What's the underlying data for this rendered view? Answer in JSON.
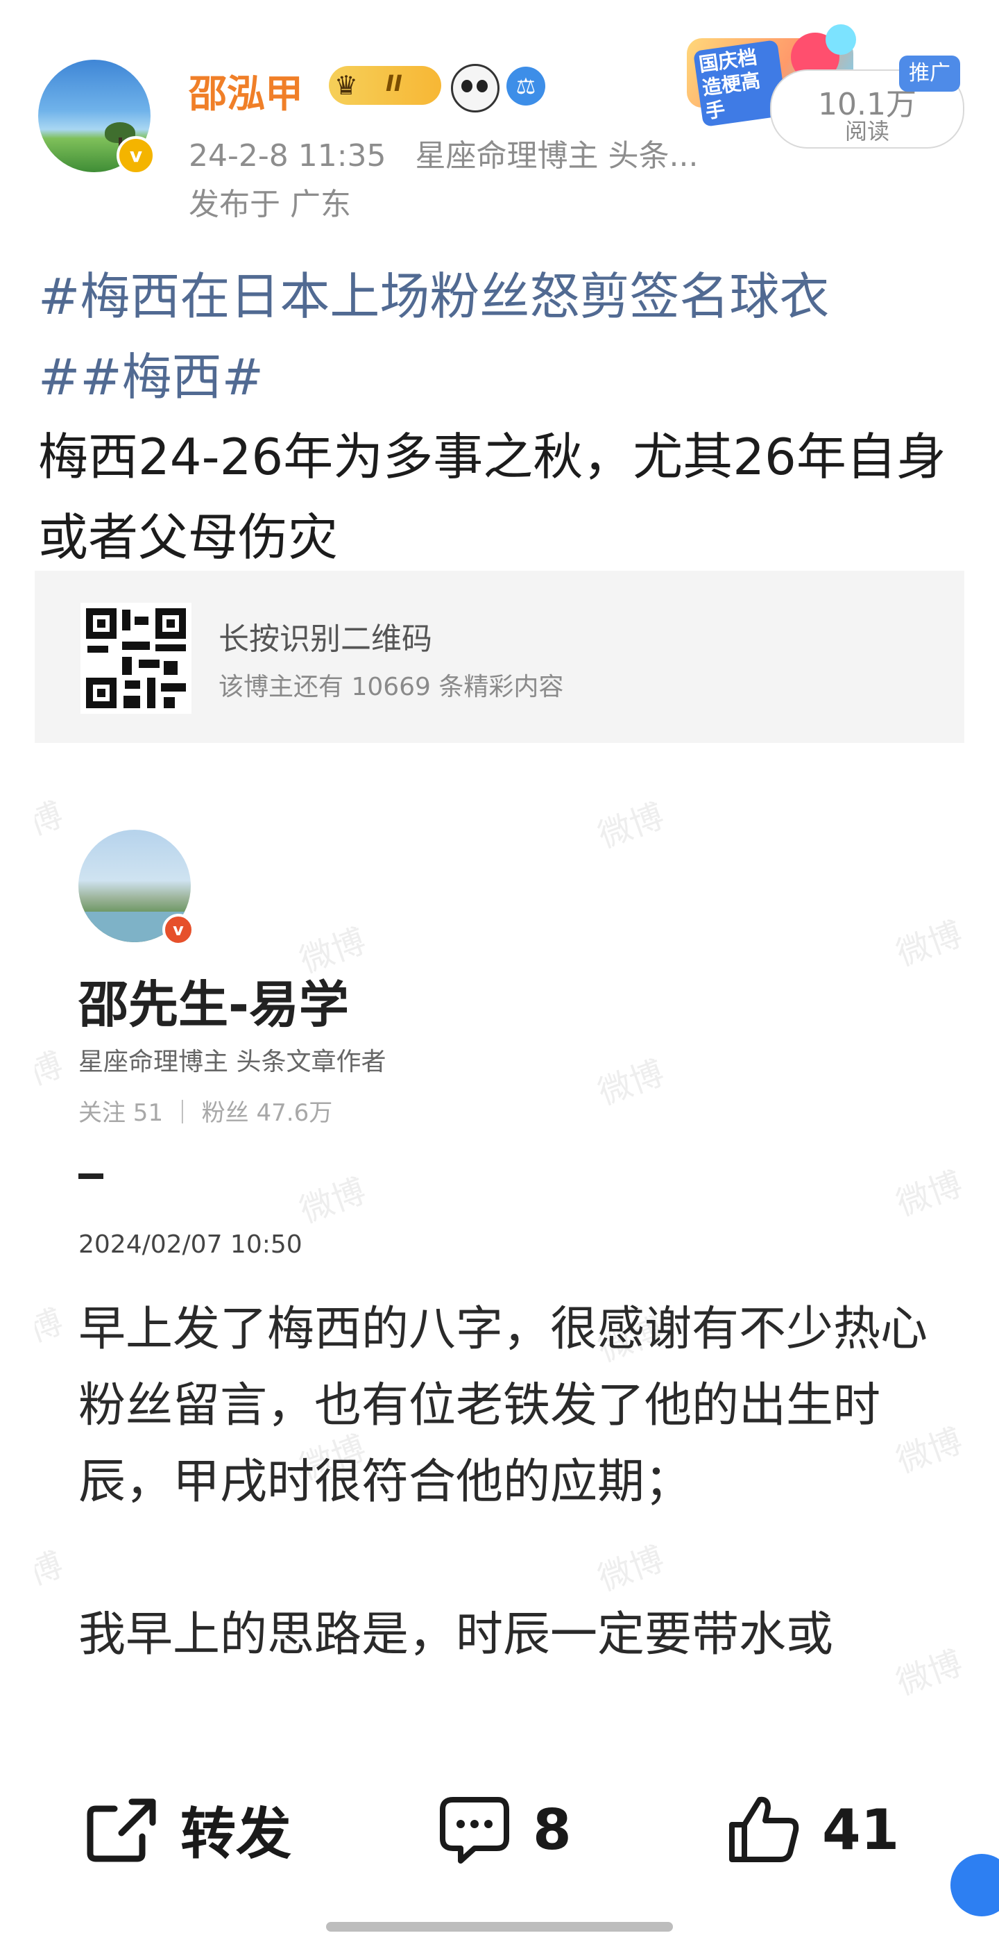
{
  "post": {
    "author": "邵泓甲",
    "level": "II",
    "timestamp": "24-2-8 11:35",
    "source": "星座命理博主 头条...",
    "location": "发布于 广东",
    "read_count": "10.1万",
    "read_label": "阅读",
    "promo_label": "推广",
    "event_badge": "国庆档造梗高手",
    "verified_mark": "v",
    "hashtag1": "#梅西在日本上场粉丝怒剪签名球衣",
    "hashtag2": "##梅西#",
    "text": "梅西24-26年为多事之秋，尤其26年自身或者父母伤灾"
  },
  "qr_card": {
    "title": "长按识别二维码",
    "subtitle": "该博主还有 10669 条精彩内容"
  },
  "embedded": {
    "author": "邵先生-易学",
    "bio": "星座命理博主 头条文章作者",
    "stats": "关注 51 ｜ 粉丝 47.6万",
    "date": "2024/02/07 10:50",
    "watermark": "微博",
    "watermark_alt": "博",
    "paragraph1": "早上发了梅西的八字，很感谢有不少热心粉丝留言，也有位老铁发了他的出生时辰，甲戌时很符合他的应期；",
    "paragraph2": "我早上的思路是，时辰一定要带水或"
  },
  "actions": {
    "repost": "转发",
    "comments": "8",
    "likes": "41"
  },
  "icons": {
    "repost": "share-arrow-icon",
    "comment": "comment-bubble-icon",
    "like": "thumbs-up-icon",
    "crown": "crown-icon",
    "panda": "panda-icon",
    "shield": "shield-icon"
  },
  "colors": {
    "author": "#f07f28",
    "hashtag": "#516a92",
    "promo": "#4e8be8",
    "meta": "#8d8d8d"
  }
}
